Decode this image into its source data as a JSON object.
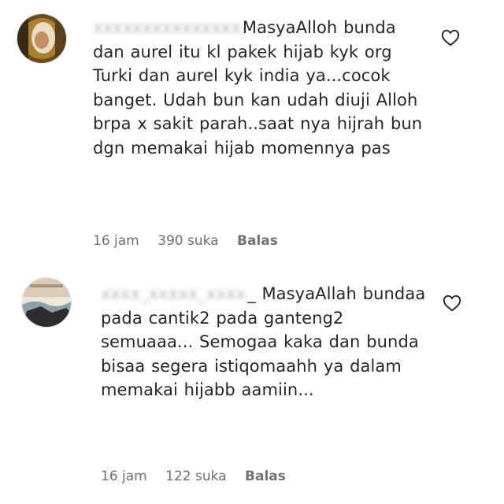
{
  "comments": [
    {
      "username": "xxxxxxxxxxxxxxx",
      "username_suffix": "",
      "text": "MasyaAlloh bunda dan aurel itu kl pakek hijab kyk org Turki dan aurel kyk india ya...cocok banget. Udah bun kan udah diuji Alloh brpa x sakit parah..saat nya hijrah bun dgn memakai hijab momennya pas",
      "time": "16 jam",
      "likes": "390 suka",
      "reply_label": "Balas",
      "avatar_icon": "profile-photo",
      "like_icon": "heart-outline-icon"
    },
    {
      "username": "xxxx_xxxxx_xxxx",
      "username_suffix": "_",
      "text": "MasyaAllah bundaa pada cantik2 pada ganteng2 semuaaa... Semogaa kaka dan bunda bisaa segera istiqomaahh ya dalam memakai hijabb aamiin...",
      "time": "16 jam",
      "likes": "122 suka",
      "reply_label": "Balas",
      "avatar_icon": "profile-photo",
      "like_icon": "heart-outline-icon"
    }
  ],
  "colors": {
    "text": "#262626",
    "meta": "#737373",
    "icon": "#262626"
  }
}
